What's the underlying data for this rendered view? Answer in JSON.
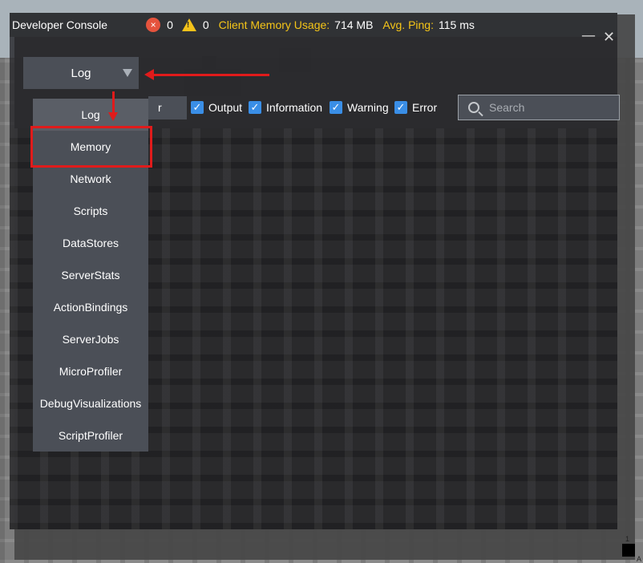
{
  "titlebar": {
    "title": "Developer Console",
    "error_count": "0",
    "warning_count": "0",
    "memory_label": "Client Memory Usage:",
    "memory_value": "714 MB",
    "ping_label": "Avg. Ping:",
    "ping_value": "115 ms",
    "error_icon_glyph": "×",
    "warning_icon_glyph": "!"
  },
  "view_select": {
    "current": "Log"
  },
  "filters": {
    "stub_text": "r",
    "checkboxes": [
      {
        "label": "Output",
        "checked": true
      },
      {
        "label": "Information",
        "checked": true
      },
      {
        "label": "Warning",
        "checked": true
      },
      {
        "label": "Error",
        "checked": true
      }
    ],
    "checkmark_glyph": "✓"
  },
  "search": {
    "placeholder": "Search",
    "icon": "search-icon"
  },
  "dropdown": {
    "items": [
      "Log",
      "Memory",
      "Network",
      "Scripts",
      "DataStores",
      "ServerStats",
      "ActionBindings",
      "ServerJobs",
      "MicroProfiler",
      "DebugVisualizations",
      "ScriptProfiler"
    ]
  },
  "window": {
    "minimize_glyph": "—",
    "close_glyph": "✕"
  },
  "corner": {
    "top_text": "1",
    "bottom_text": "A"
  },
  "colors": {
    "accent_yellow": "#f5c518",
    "error_red": "#e5533d",
    "warning_yellow": "#f3c21a",
    "checkbox_blue": "#3a8ee6",
    "annotation_red": "#e01b1b"
  }
}
